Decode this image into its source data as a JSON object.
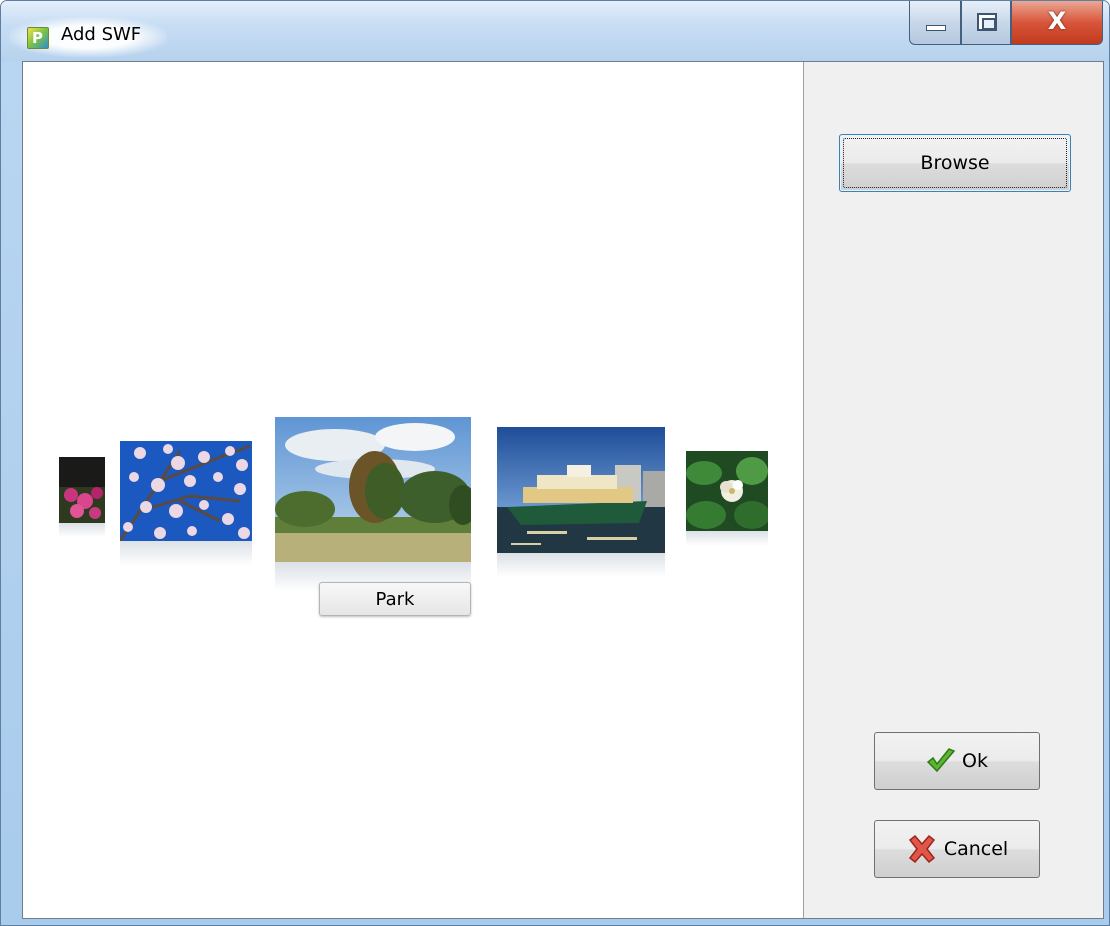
{
  "window": {
    "title": "Add SWF",
    "app_icon_letter": "P",
    "close_glyph": "X"
  },
  "gallery": {
    "caption": "Park",
    "thumbnails": [
      {
        "name": "pink-flowers",
        "colors": [
          "#1a1a18",
          "#c8357c"
        ]
      },
      {
        "name": "blossoms",
        "colors": [
          "#1b58c0",
          "#e9d6e2"
        ]
      },
      {
        "name": "park",
        "colors": [
          "#7fb0e0",
          "#3f6a2a"
        ]
      },
      {
        "name": "ferry",
        "colors": [
          "#1f4d98",
          "#213744"
        ]
      },
      {
        "name": "leaf-flower",
        "colors": [
          "#2e6c32",
          "#f1eee2"
        ]
      }
    ]
  },
  "buttons": {
    "browse_label": "Browse",
    "ok_label": "Ok",
    "cancel_label": "Cancel"
  },
  "icons": {
    "ok": "checkmark-icon",
    "cancel": "red-x-icon"
  }
}
